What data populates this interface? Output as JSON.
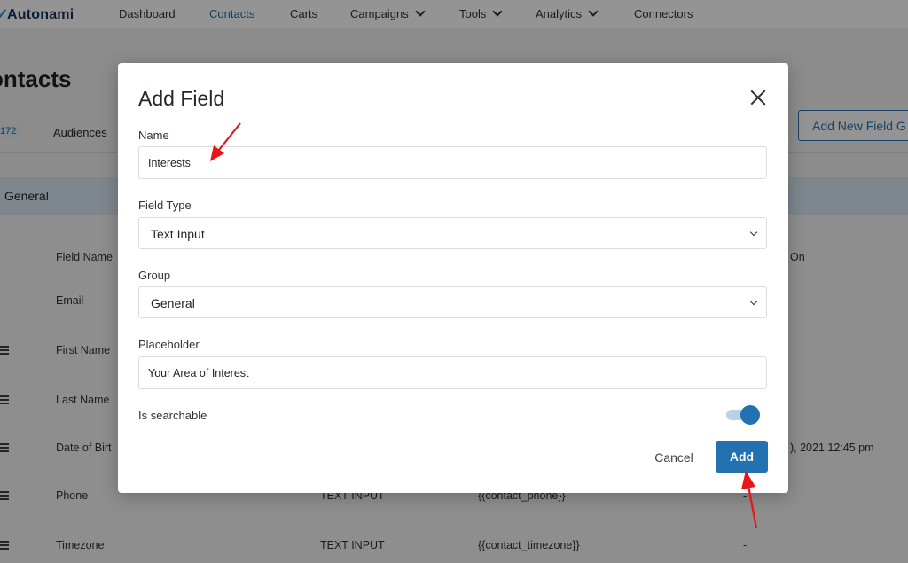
{
  "app": {
    "logo": "Autonami",
    "nav": [
      {
        "label": "Dashboard",
        "active": false,
        "dropdown": false
      },
      {
        "label": "Contacts",
        "active": true,
        "dropdown": false
      },
      {
        "label": "Carts",
        "active": false,
        "dropdown": false
      },
      {
        "label": "Campaigns",
        "active": false,
        "dropdown": true
      },
      {
        "label": "Tools",
        "active": false,
        "dropdown": true
      },
      {
        "label": "Analytics",
        "active": false,
        "dropdown": true
      },
      {
        "label": "Connectors",
        "active": false,
        "dropdown": false
      }
    ]
  },
  "page": {
    "title": "ontacts",
    "count_badge": "172",
    "subtab": "Audiences",
    "add_group_button": "Add New Field G",
    "group_title": "General",
    "header_cols": {
      "field_name": "Field Name",
      "created_on": "On"
    },
    "rows": [
      {
        "name": "Email",
        "type": "",
        "merge_tag": "",
        "created": "",
        "draggable": false
      },
      {
        "name": "First Name",
        "type": "",
        "merge_tag": "",
        "created": "",
        "draggable": true
      },
      {
        "name": "Last Name",
        "type": "",
        "merge_tag": "",
        "created": "",
        "draggable": true
      },
      {
        "name": "Date of Birt",
        "type": "",
        "merge_tag": "",
        "created": "), 2021 12:45 pm",
        "draggable": true
      },
      {
        "name": "Phone",
        "type": "TEXT INPUT",
        "merge_tag": "{{contact_phone}}",
        "created": "-",
        "draggable": true
      },
      {
        "name": "Timezone",
        "type": "TEXT INPUT",
        "merge_tag": "{{contact_timezone}}",
        "created": "-",
        "draggable": true
      }
    ]
  },
  "modal": {
    "title": "Add Field",
    "name_label": "Name",
    "name_value": "Interests",
    "field_type_label": "Field Type",
    "field_type_value": "Text Input",
    "group_label": "Group",
    "group_value": "General",
    "placeholder_label": "Placeholder",
    "placeholder_value": "Your Area of Interest",
    "searchable_label": "Is searchable",
    "searchable_on": true,
    "cancel_label": "Cancel",
    "add_label": "Add"
  },
  "colors": {
    "accent": "#2271b1",
    "annotation_arrow": "#e8161b",
    "group_bar": "#d9e9f3"
  }
}
